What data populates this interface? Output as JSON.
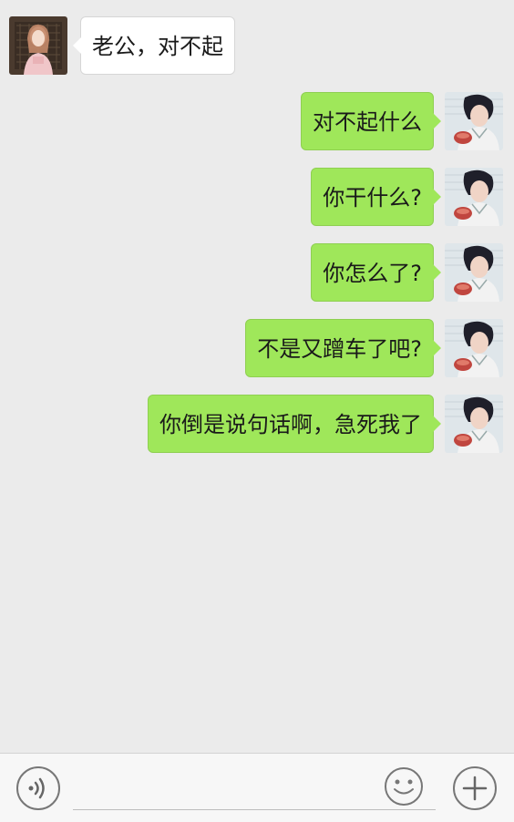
{
  "messages": [
    {
      "side": "incoming",
      "text": "老公，对不起"
    },
    {
      "side": "outgoing",
      "text": "对不起什么"
    },
    {
      "side": "outgoing",
      "text": "你干什么?"
    },
    {
      "side": "outgoing",
      "text": "你怎么了?"
    },
    {
      "side": "outgoing",
      "text": "不是又蹭车了吧?"
    },
    {
      "side": "outgoing",
      "text": "你倒是说句话啊，急死我了"
    }
  ],
  "input_bar": {
    "text_value": "",
    "voice_icon": "voice-icon",
    "emoji_icon": "emoji-icon",
    "plus_icon": "plus-icon"
  },
  "colors": {
    "background": "#ebebeb",
    "incoming_bubble": "#ffffff",
    "outgoing_bubble": "#9fe75a"
  }
}
